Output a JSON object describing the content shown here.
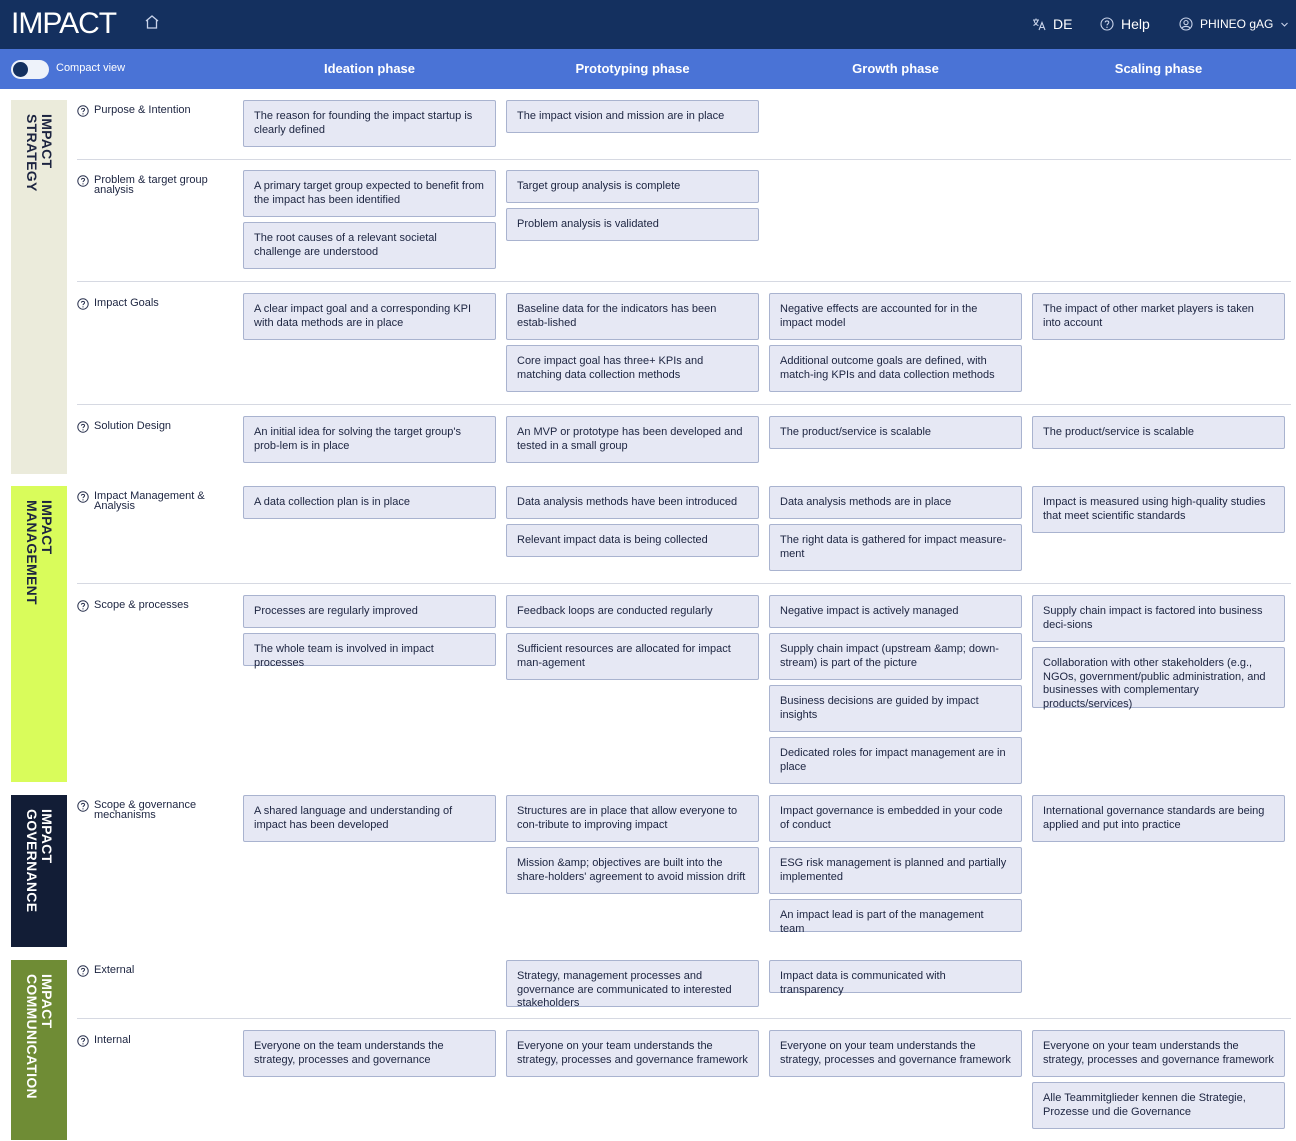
{
  "header": {
    "logo": "IMPACT",
    "language": "DE",
    "help": "Help",
    "account": "PHINEO gAG"
  },
  "toolbar": {
    "compact_view_label": "Compact view",
    "compact_view_on": false
  },
  "phases": [
    "Ideation phase",
    "Prototyping phase",
    "Growth phase",
    "Scaling phase"
  ],
  "categories": [
    {
      "name": "IMPACT\nSTRATEGY",
      "color": "#ebebdb",
      "text_color": "#1c2440"
    },
    {
      "name": "IMPACT\nMANAGEMENT",
      "color": "#d9fc5b",
      "text_color": "#1c2440"
    },
    {
      "name": "IMPACT\nGOVERNANCE",
      "color": "#121d36",
      "text_color": "#ffffff"
    },
    {
      "name": "IMPACT\nCOMMUNICATION",
      "color": "#6f8c35",
      "text_color": "#ffffff"
    }
  ],
  "rows": [
    {
      "label": "Purpose & Intention",
      "cells": [
        [
          "The reason for founding the impact startup is clearly defined"
        ],
        [
          "The impact vision and mission are in place"
        ],
        [],
        []
      ]
    },
    {
      "label": "Problem & target group analysis",
      "cells": [
        [
          "A primary target group expected to benefit from the impact has been identified",
          "The root causes of a relevant societal challenge are understood"
        ],
        [
          "Target group analysis is complete",
          "Problem analysis is validated"
        ],
        [],
        []
      ]
    },
    {
      "label": "Impact Goals",
      "cells": [
        [
          "A clear impact goal and a corresponding KPI with data methods are in place"
        ],
        [
          "Baseline data for the indicators has been estab-lished",
          "Core impact goal has three+ KPIs and matching data collection methods"
        ],
        [
          "Negative effects are accounted for in the impact model",
          "Additional outcome goals are defined, with match-ing KPIs and data collection methods"
        ],
        [
          "The impact of other market players is taken into account"
        ]
      ]
    },
    {
      "label": "Solution Design",
      "cells": [
        [
          "An initial idea for solving the target group's prob-lem is in place"
        ],
        [
          "An MVP or prototype has been developed and tested in a small group"
        ],
        [
          "The product/service is scalable"
        ],
        [
          "The product/service is scalable"
        ]
      ]
    },
    {
      "label": "Impact Management & Analysis",
      "cells": [
        [
          "A data collection plan is in place"
        ],
        [
          "Data analysis methods have been introduced",
          "Relevant impact data is being collected"
        ],
        [
          "Data analysis methods are in place",
          "The right data is gathered for impact measure-ment"
        ],
        [
          "Impact is measured using high-quality studies that meet scientific standards"
        ]
      ]
    },
    {
      "label": "Scope & processes",
      "cells": [
        [
          "Processes are regularly improved",
          "The whole team is involved in impact processes"
        ],
        [
          "Feedback loops are conducted regularly",
          "Sufficient resources are allocated for impact man-agement"
        ],
        [
          "Negative impact is actively managed",
          "Supply chain impact (upstream &amp; down-stream) is part of the picture",
          "Business decisions are guided by impact insights",
          "Dedicated roles for impact management are in place"
        ],
        [
          "Supply chain impact is factored into business deci-sions",
          "Collaboration with other stakeholders (e.g., NGOs, government/public administration, and businesses with complementary products/services)"
        ]
      ]
    },
    {
      "label": "Scope & governance mechanisms",
      "cells": [
        [
          "A shared language and understanding of impact has been developed"
        ],
        [
          "Structures are in place that allow everyone to con-tribute to improving impact",
          "Mission &amp; objectives are built into the share-holders' agreement to avoid mission drift"
        ],
        [
          "Impact governance is embedded in your code of conduct",
          "ESG risk management is planned and partially implemented",
          "An impact lead is part of the management team"
        ],
        [
          "International governance standards are being applied and put into practice"
        ]
      ]
    },
    {
      "label": "External",
      "cells": [
        [],
        [
          "Strategy, management processes and governance are communicated to interested stakeholders"
        ],
        [
          "Impact data is communicated with transparency"
        ],
        []
      ]
    },
    {
      "label": "Internal",
      "cells": [
        [
          "Everyone on the team understands the strategy, processes and governance"
        ],
        [
          "Everyone on your team understands the strategy, processes and governance framework"
        ],
        [
          "Everyone on your team understands the strategy, processes and governance framework"
        ],
        [
          "Everyone on your team understands the strategy, processes and governance framework",
          "Alle Teammitglieder kennen die Strategie, Prozesse und die Governance"
        ]
      ]
    }
  ]
}
